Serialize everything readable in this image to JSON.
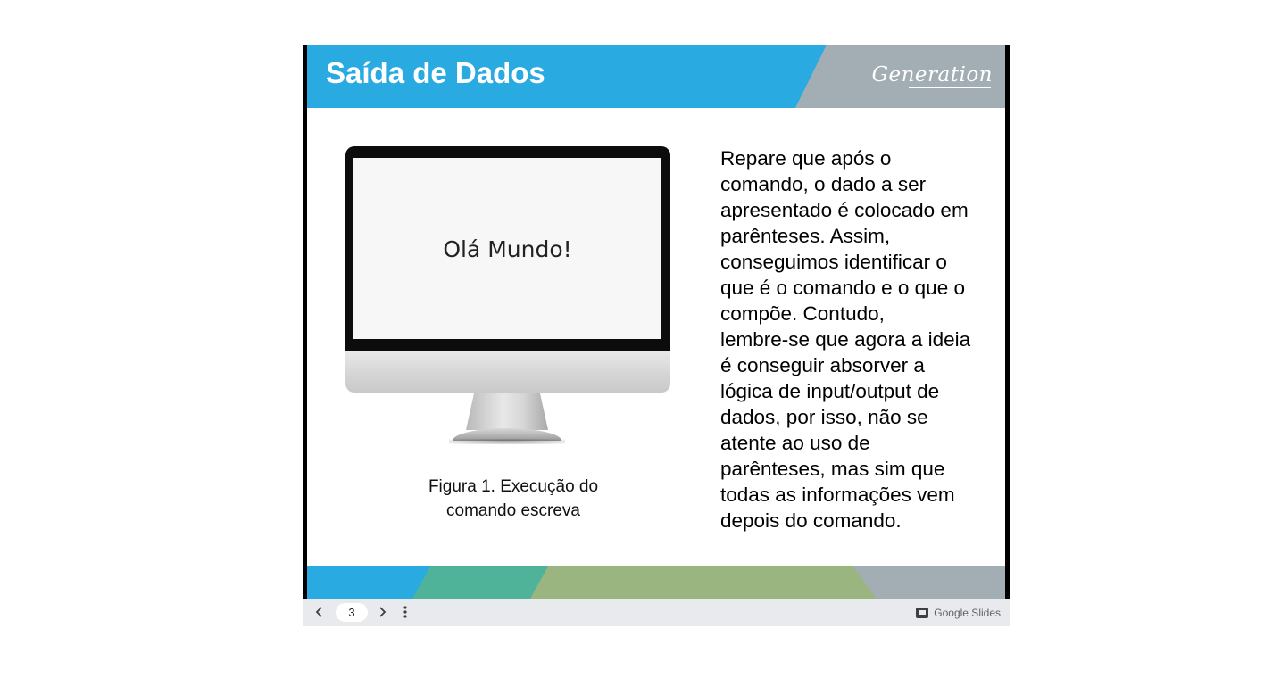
{
  "slide": {
    "title": "Saída de Dados",
    "logo_text": "Generation",
    "screen_text": "Olá Mundo!",
    "caption_line1": "Figura 1. Execução do",
    "caption_line2": "comando escreva",
    "body_text": "Repare que após o\ncomando, o dado a ser\napresentado é colocado em\nparênteses. Assim,\nconseguimos identificar o\nque é o comando e o que o\ncompõe. Contudo,\nlembre-se que agora a ideia\né conseguir absorver a\nlógica de input/output de\ndados, por isso, não se\natente ao uso de\nparênteses, mas sim que\ntodas as informações vem\ndepois do comando."
  },
  "toolbar": {
    "prev_icon": "chevron-left-icon",
    "page_number": "3",
    "next_icon": "chevron-right-icon",
    "more_icon": "more-vert-icon",
    "brand_label": "Google Slides",
    "brand_icon": "slides-icon"
  },
  "colors": {
    "header_blue": "#29abe2",
    "header_gray": "#a3adb4",
    "footer_teal": "#4fb39a",
    "footer_green": "#9bb581",
    "toolbar_bg": "#e8eaed"
  }
}
